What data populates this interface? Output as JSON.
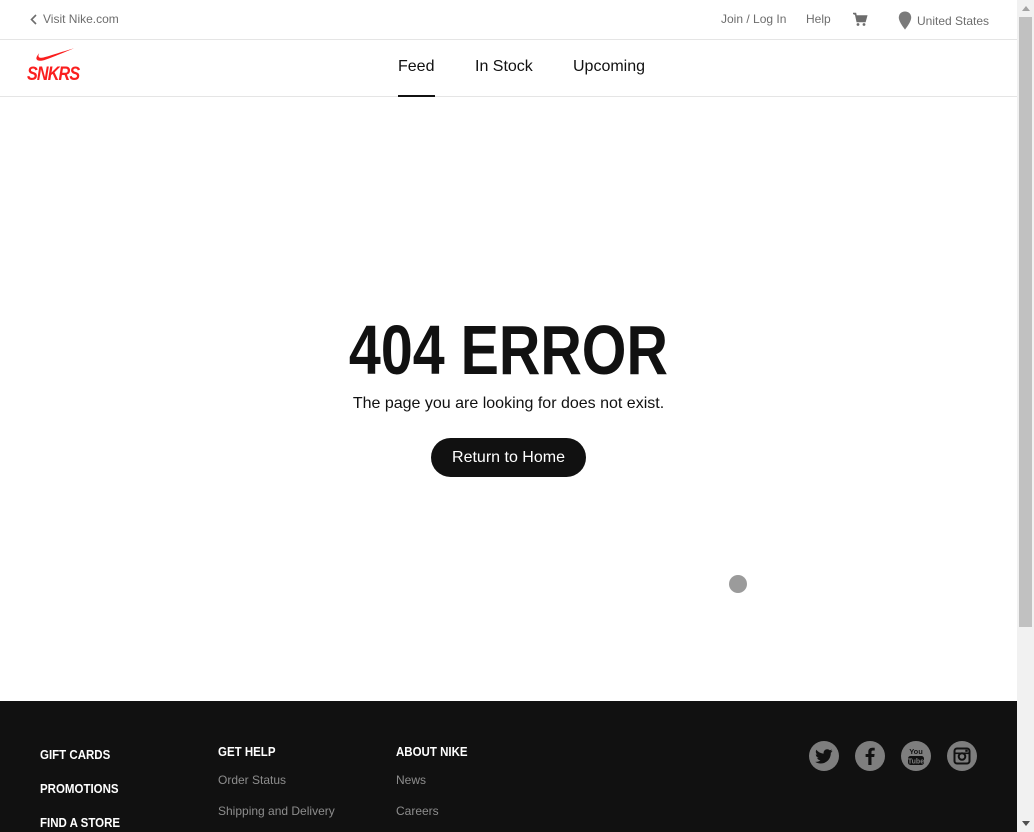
{
  "topbar": {
    "visit_label": "Visit Nike.com",
    "join_label": "Join / Log In",
    "help_label": "Help",
    "location_label": "United States"
  },
  "nav": {
    "logo_text": "SNKRS",
    "tabs": [
      {
        "label": "Feed",
        "active": true
      },
      {
        "label": "In Stock",
        "active": false
      },
      {
        "label": "Upcoming",
        "active": false
      }
    ]
  },
  "error": {
    "title": "404 ERROR",
    "message": "The page you are looking for does not exist.",
    "button_label": "Return to Home"
  },
  "footer": {
    "main_links": [
      "GIFT CARDS",
      "PROMOTIONS",
      "FIND A STORE"
    ],
    "help": {
      "heading": "GET HELP",
      "links": [
        "Order Status",
        "Shipping and Delivery"
      ]
    },
    "about": {
      "heading": "ABOUT NIKE",
      "links": [
        "News",
        "Careers"
      ]
    },
    "social": [
      "twitter-icon",
      "facebook-icon",
      "youtube-icon",
      "instagram-icon"
    ]
  },
  "colors": {
    "brand_red": "#fa1e1e",
    "text": "#111111",
    "muted": "#6d6d6d",
    "footer_bg": "#111111"
  }
}
